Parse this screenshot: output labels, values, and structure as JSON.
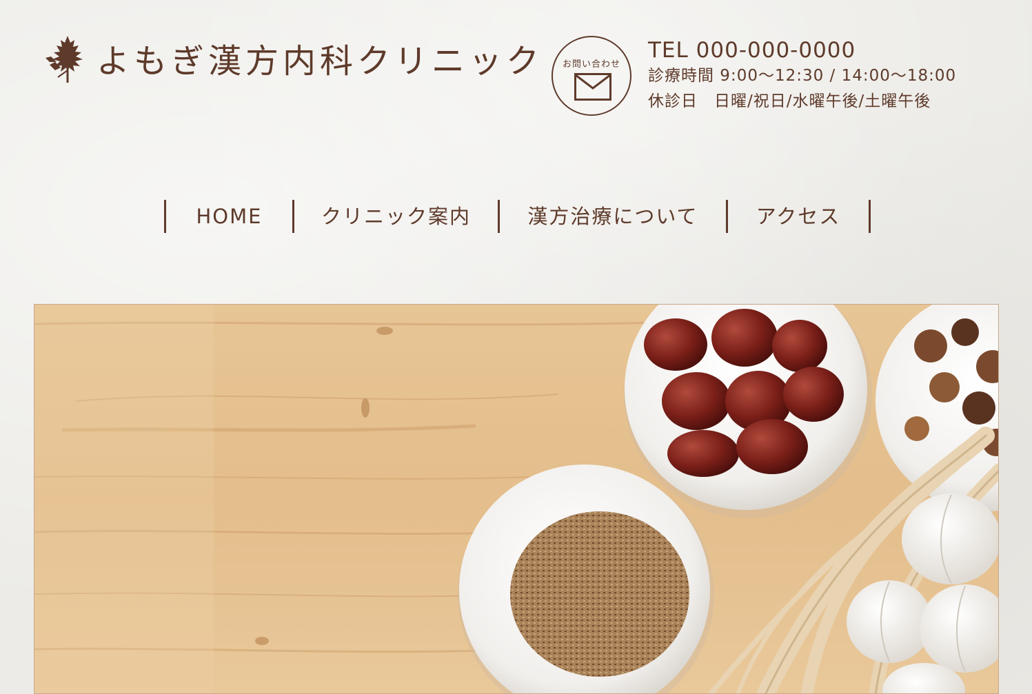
{
  "header": {
    "logo_text": "よもぎ漢方内科クリニック",
    "contact_label": "お問い合わせ",
    "tel": "TEL 000-000-0000",
    "hours": "診療時間 9:00〜12:30 / 14:00〜18:00",
    "closed": "休診日　日曜/祝日/水曜午後/土曜午後"
  },
  "nav": {
    "items": [
      {
        "label": "HOME"
      },
      {
        "label": "クリニック案内"
      },
      {
        "label": "漢方治療について"
      },
      {
        "label": "アクセス"
      }
    ]
  },
  "colors": {
    "brand": "#5e3a2a",
    "background": "#ecebe7",
    "wood": "#e2bd8e"
  },
  "icons": {
    "logo": "mugwort-leaf-icon",
    "contact": "envelope-icon"
  }
}
